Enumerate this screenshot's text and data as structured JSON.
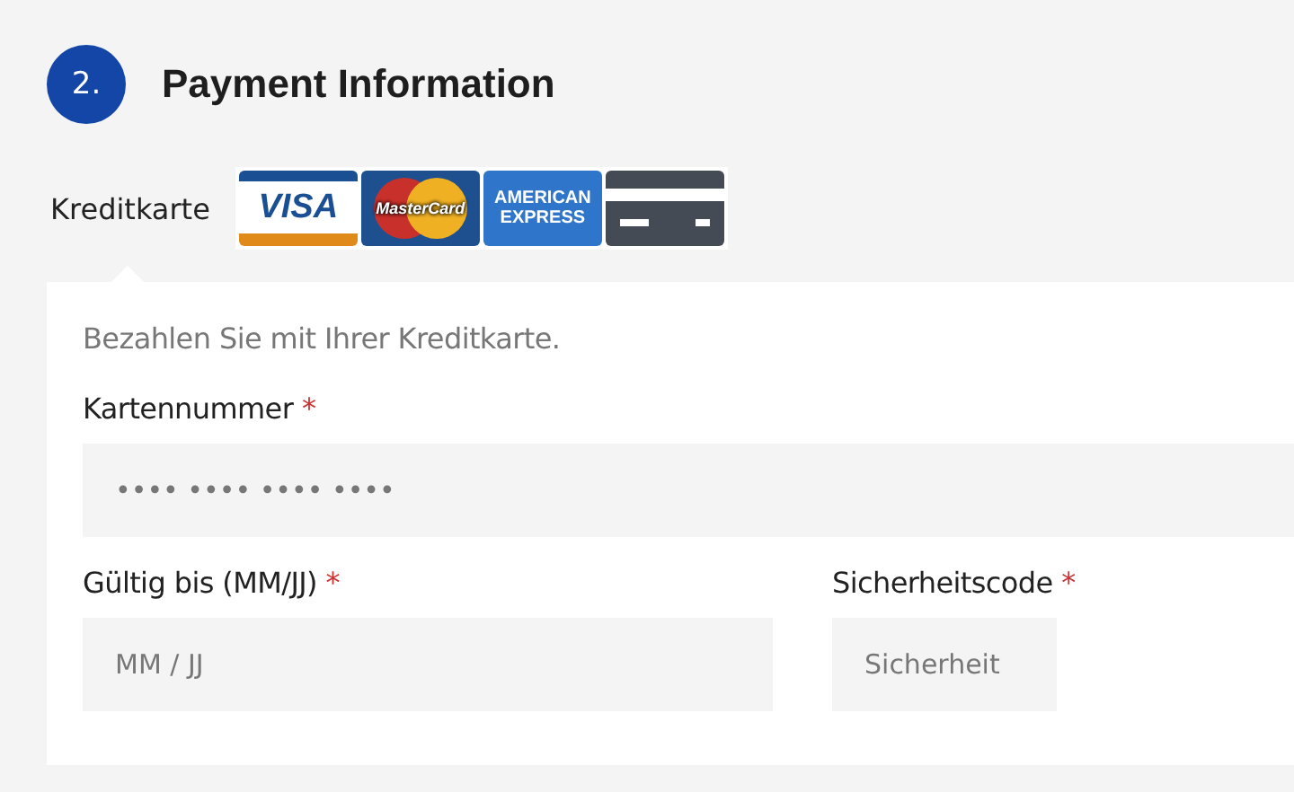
{
  "step": {
    "number": "2.",
    "title": "Payment Information"
  },
  "payment_method": {
    "label": "Kreditkarte",
    "cards": [
      {
        "kind": "visa",
        "lines": [
          "VISA"
        ]
      },
      {
        "kind": "mastercard",
        "lines": [
          "MasterCard"
        ]
      },
      {
        "kind": "amex",
        "lines": [
          "AMERICAN",
          "EXPRESS"
        ]
      },
      {
        "kind": "generic"
      }
    ]
  },
  "panel": {
    "intro": "Bezahlen Sie mit Ihrer Kreditkarte.",
    "fields": [
      {
        "label": "Kartennummer",
        "required_mark": "*",
        "placeholder": "•••• •••• •••• ••••"
      },
      {
        "label": "Gültig bis (MM/JJ)",
        "required_mark": "*",
        "placeholder": "MM / JJ"
      },
      {
        "label": "Sicherheitscode",
        "required_mark": "*",
        "placeholder": "Sicherheit"
      }
    ]
  }
}
